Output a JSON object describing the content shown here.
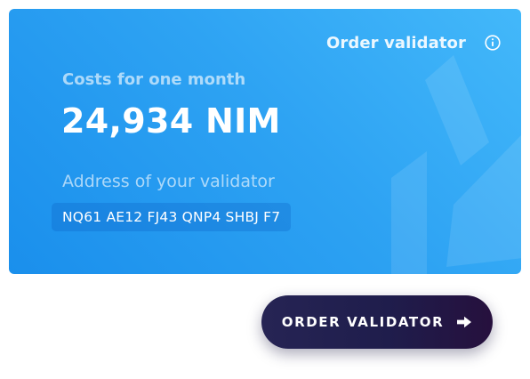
{
  "card": {
    "header_label": "Order validator",
    "costs_label": "Costs for one month",
    "costs_value": "24,934 NIM",
    "address_label": "Address of your validator",
    "address_value": "NQ61 AE12 FJ43 QNP4 SHBJ F7"
  },
  "actions": {
    "order_button_label": "ORDER VALIDATOR"
  },
  "icons": {
    "info": "info-icon",
    "arrow": "arrow-right-icon",
    "decoration": "nimiq-hexagon-watermark"
  },
  "colors": {
    "card_light": "#43b8fa",
    "card_dark": "#1a8fec",
    "button_dark": "#1f1d4c",
    "text_white": "#ffffff"
  }
}
